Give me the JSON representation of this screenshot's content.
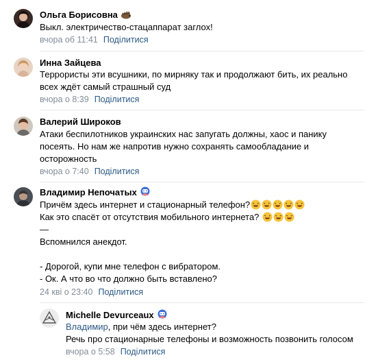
{
  "comments": [
    {
      "author": "Ольга Борисовна",
      "badge_icon": "hedgehog-icon",
      "text": "Выкл. электричество-стацаппарат заглох!",
      "time": "вчора об 11:41",
      "share_label": "Поділитися"
    },
    {
      "author": "Инна Зайцева",
      "text_lines": [
        "Террористы эти всушники, по мирняку так и продолжают бить, их реально",
        "всех ждёт самый страшный суд"
      ],
      "time": "вчора о 8:39",
      "share_label": "Поділитися"
    },
    {
      "author": "Валерий Широков",
      "text_lines": [
        "Атаки беспилотников украинских нас запугать должны, хаос и панику",
        "посеять. Но нам же напротив нужно сохранять самообладание и",
        "осторожность"
      ],
      "time": "вчора о 7:40",
      "share_label": "Поділитися"
    },
    {
      "author": "Владимир Непочатых",
      "badge_icon": "astronaut-icon",
      "text_lines": [
        "Причём здесь интернет и стационарный телефон?",
        "Как это спасёт от отсутствия мобильного интернета?",
        "—",
        "Вспомнился анекдот.",
        "",
        "- Дорогой, купи мне телефон с вибратором.",
        "- Ок. А что во что должно быть вставлено?"
      ],
      "time": "24 кві о 23:40",
      "share_label": "Поділитися"
    },
    {
      "author": "Michelle Devurceaux",
      "badge_icon": "astronaut-icon",
      "mention": "Владимир",
      "text_lines": [
        ", при чём здесь интернет?",
        "Речь про стационарные телефоны и возможность позвонить голосом"
      ],
      "time": "вчора о 5:58",
      "share_label": "Поділитися"
    }
  ],
  "colors": {
    "link": "#2a5885",
    "meta": "#818c99",
    "divider": "#e7e8ec"
  }
}
